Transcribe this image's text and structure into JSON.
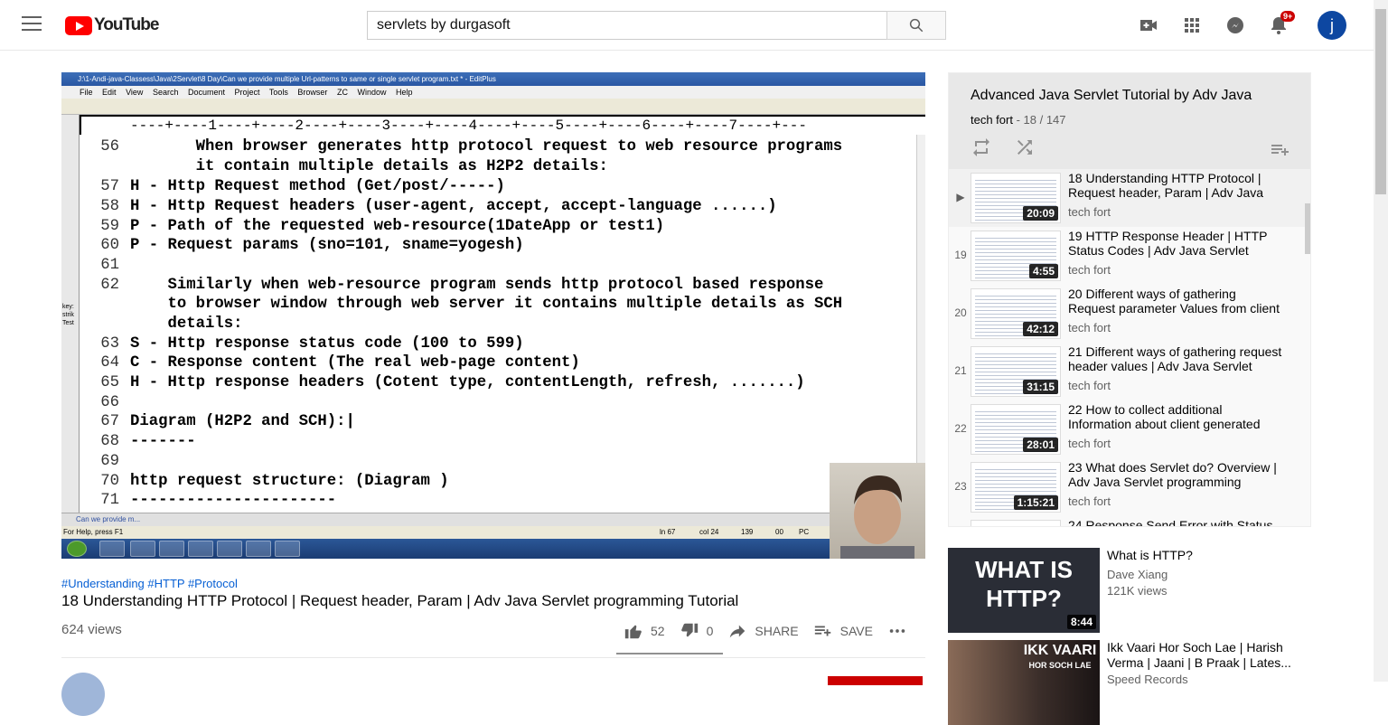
{
  "header": {
    "logo_text": "YouTube",
    "search_value": "servlets by durgasoft",
    "notifications_badge": "9+",
    "avatar_letter": "j"
  },
  "editor": {
    "window_title": "J:\\1-Andi-java-Classess\\Java\\2Servlet\\8 Day\\Can we provide multiple Url-patterns to same or single servlet program.txt * - EditPlus",
    "menu": [
      "File",
      "Edit",
      "View",
      "Search",
      "Document",
      "Project",
      "Tools",
      "Browser",
      "ZC",
      "Window",
      "Help"
    ],
    "ruler": "----+----1----+----2----+----3----+----4----+----5----+----6----+----7----+---",
    "side_note": [
      "key:",
      "strik",
      "Test"
    ],
    "lines": [
      {
        "num": "56",
        "text": "       When browser generates http protocol request to web resource programs"
      },
      {
        "num": "",
        "text": "       it contain multiple details as H2P2 details:"
      },
      {
        "num": "57",
        "text": "H - Http Request method (Get/post/-----)"
      },
      {
        "num": "58",
        "text": "H - Http Request headers (user-agent, accept, accept-language ......)"
      },
      {
        "num": "59",
        "text": "P - Path of the requested web-resource(1DateApp or test1)"
      },
      {
        "num": "60",
        "text": "P - Request params (sno=101, sname=yogesh)"
      },
      {
        "num": "61",
        "text": ""
      },
      {
        "num": "62",
        "text": "    Similarly when web-resource program sends http protocol based response"
      },
      {
        "num": "",
        "text": "    to browser window through web server it contains multiple details as SCH"
      },
      {
        "num": "",
        "text": "    details:"
      },
      {
        "num": "63",
        "text": "S - Http response status code (100 to 599)"
      },
      {
        "num": "64",
        "text": "C - Response content (The real web-page content)"
      },
      {
        "num": "65",
        "text": "H - Http response headers (Cotent type, contentLength, refresh, .......)"
      },
      {
        "num": "66",
        "text": ""
      },
      {
        "num": "67",
        "text": "Diagram (H2P2 and SCH):|"
      },
      {
        "num": "68",
        "text": "-------"
      },
      {
        "num": "69",
        "text": ""
      },
      {
        "num": "70",
        "text": "http request structure: (Diagram )"
      },
      {
        "num": "71",
        "text": "----------------------"
      }
    ],
    "tab_label": "Can we provide m...",
    "status_help": "For Help, press F1",
    "status_ln": "ln 67",
    "status_col": "col 24",
    "status_n": "139",
    "status_oo": "00",
    "status_pc": "PC"
  },
  "video": {
    "tags": "#Understanding #HTTP #Protocol",
    "title": "18 Understanding HTTP Protocol | Request header, Param | Adv Java Servlet programming Tutorial",
    "views": "624 views",
    "likes": "52",
    "dislikes": "0",
    "share_label": "SHARE",
    "save_label": "SAVE",
    "channel_partial": "tech fort"
  },
  "playlist": {
    "title": "Advanced Java Servlet Tutorial by Adv Java",
    "channel": "tech fort",
    "position": " - 18 / 147",
    "items": [
      {
        "idx": "▶",
        "title": "18 Understanding HTTP Protocol | Request header, Param | Adv Java",
        "channel": "tech fort",
        "duration": "20:09"
      },
      {
        "idx": "19",
        "title": "19 HTTP Response Header | HTTP Status Codes | Adv Java Servlet",
        "channel": "tech fort",
        "duration": "4:55"
      },
      {
        "idx": "20",
        "title": "20 Different ways of gathering Request parameter Values from client request",
        "channel": "tech fort",
        "duration": "42:12"
      },
      {
        "idx": "21",
        "title": "21 Different ways of gathering request header values | Adv Java Servlet",
        "channel": "tech fort",
        "duration": "31:15"
      },
      {
        "idx": "22",
        "title": "22 How to collect additional Information about client generated",
        "channel": "tech fort",
        "duration": "28:01"
      },
      {
        "idx": "23",
        "title": "23 What does Servlet do? Overview | Adv Java Servlet programming Tutorial",
        "channel": "tech fort",
        "duration": "1:15:21"
      },
      {
        "idx": "",
        "title": "24 Response Send Error with Status",
        "channel": "",
        "duration": ""
      }
    ]
  },
  "recommendations": [
    {
      "title": "What is HTTP?",
      "channel": "Dave Xiang",
      "meta": "121K views",
      "duration": "8:44",
      "thumb_text_1": "WHAT IS",
      "thumb_text_2": "HTTP?"
    },
    {
      "title": "Ikk Vaari Hor Soch Lae | Harish Verma | Jaani | B Praak | Lates...",
      "channel": "Speed Records",
      "meta": "",
      "duration": "",
      "thumb_text_1": "IKK VAARI",
      "thumb_text_2": "HOR SOCH LAE"
    }
  ]
}
